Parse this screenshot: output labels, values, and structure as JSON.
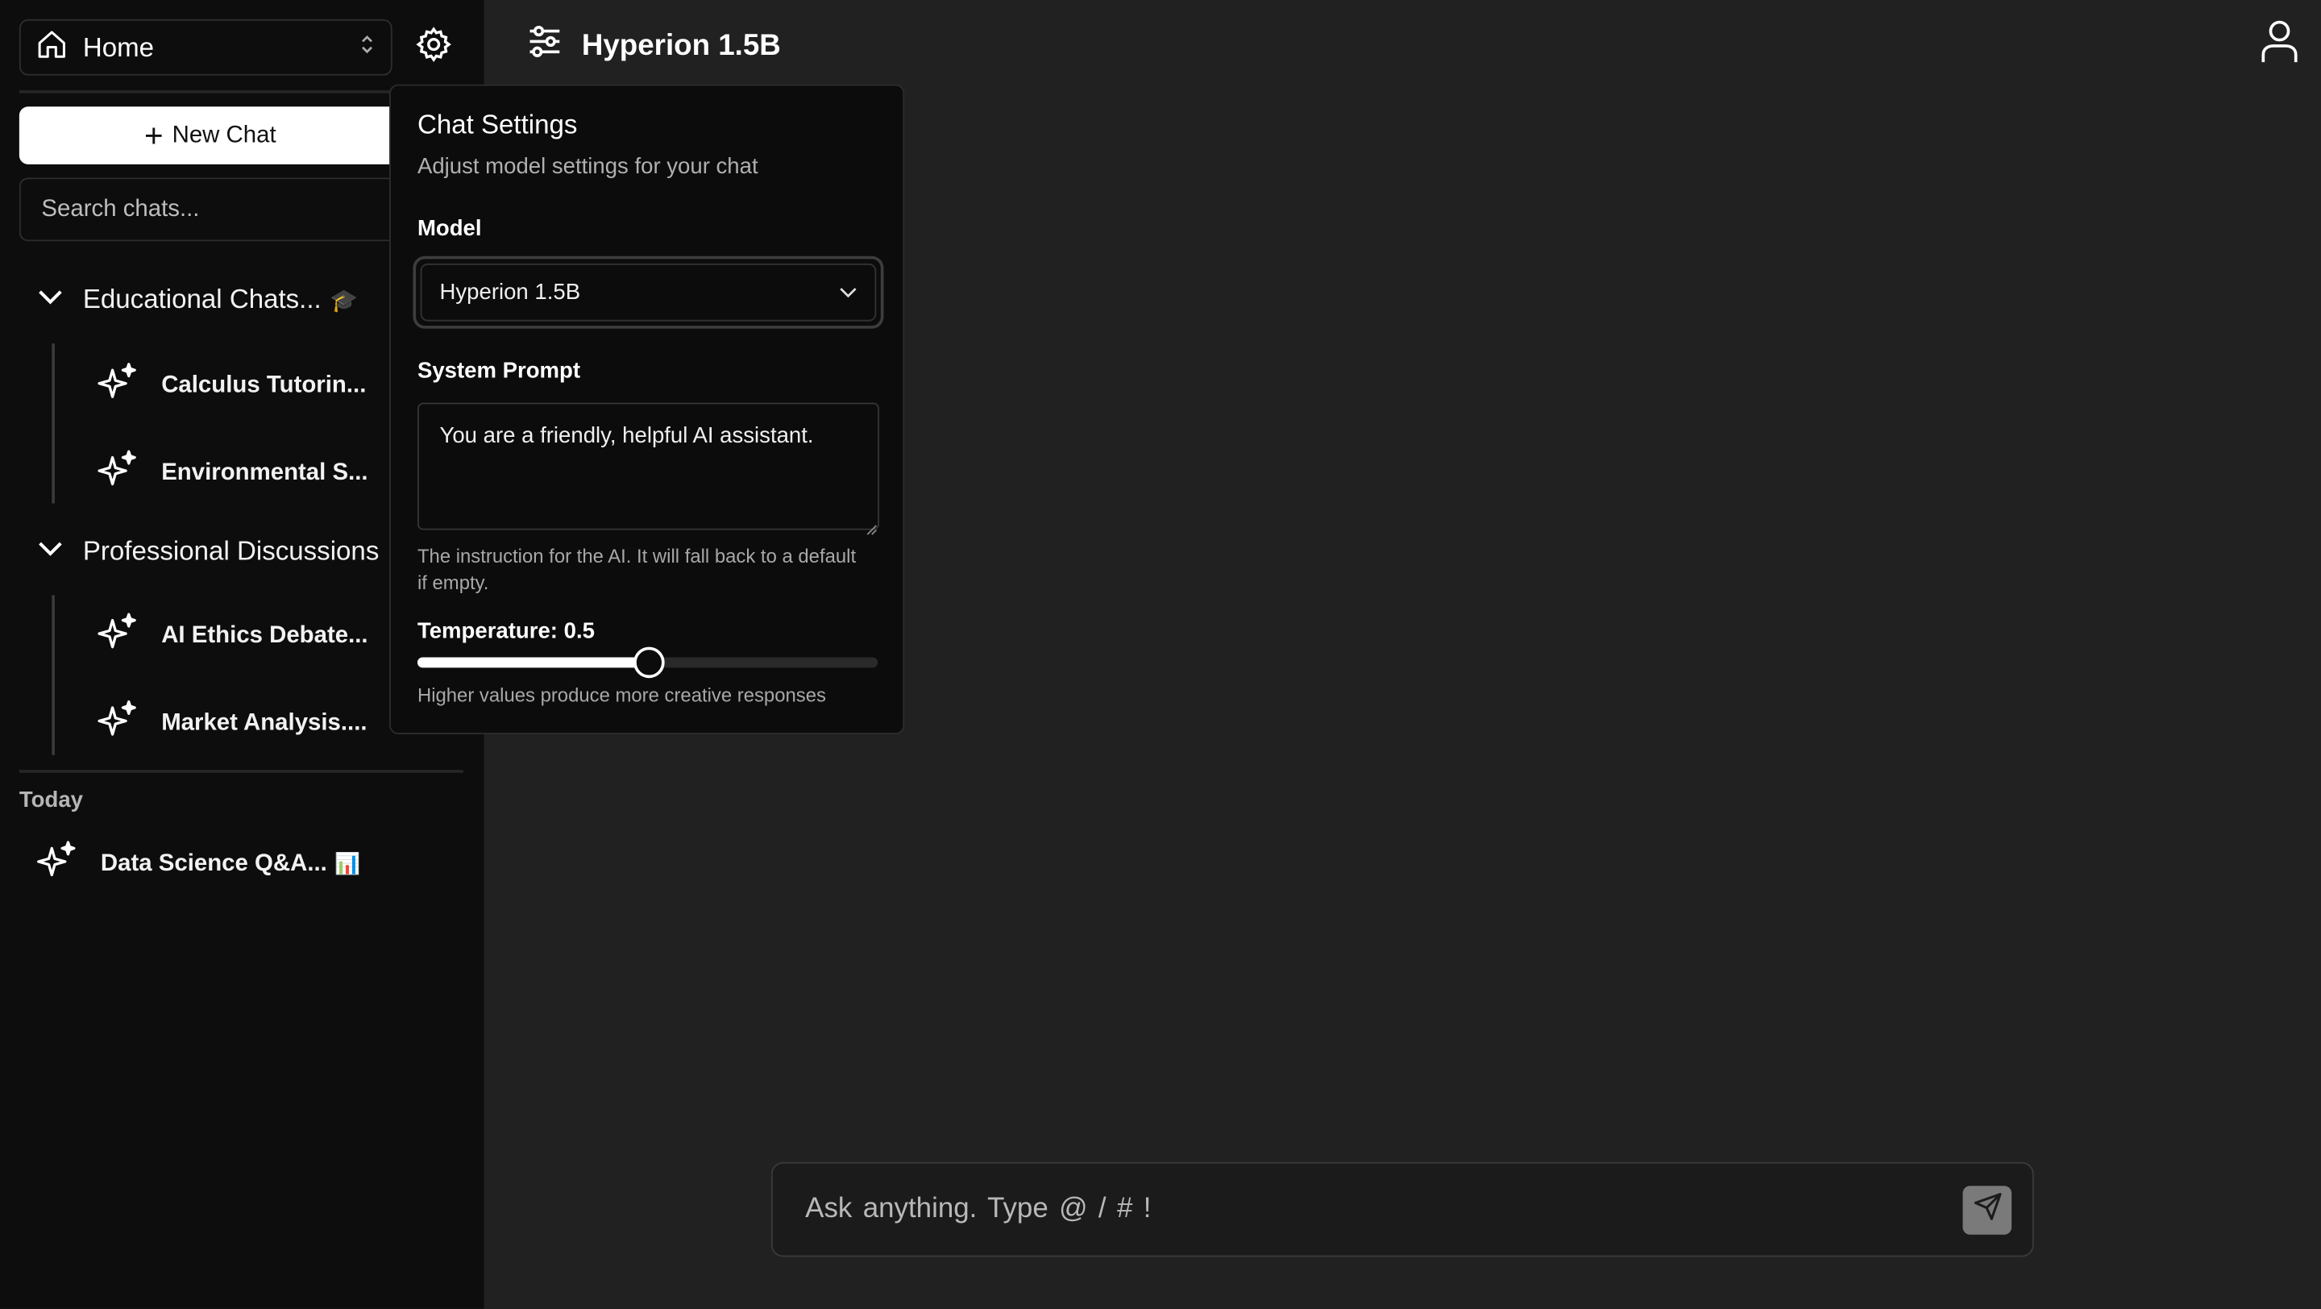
{
  "workspace": {
    "label": "Home",
    "icon": "home-icon"
  },
  "sidebar": {
    "new_chat_label": "New Chat",
    "search_placeholder": "Search chats...",
    "folders": [
      {
        "name": "Educational Chats...",
        "emoji": "🎓",
        "chats": [
          {
            "title": "Calculus Tutorin..."
          },
          {
            "title": "Environmental S..."
          }
        ]
      },
      {
        "name": "Professional Discussions",
        "emoji": "",
        "chats": [
          {
            "title": "AI Ethics Debate..."
          },
          {
            "title": "Market Analysis...."
          }
        ]
      }
    ],
    "sections": [
      {
        "label": "Today",
        "chats": [
          {
            "title": "Data Science Q&A...",
            "emoji": "📊"
          }
        ]
      }
    ]
  },
  "header": {
    "model_title": "Hyperion 1.5B",
    "icon": "sliders-icon"
  },
  "chat_settings": {
    "title": "Chat Settings",
    "subtitle": "Adjust model settings for your chat",
    "model_label": "Model",
    "model_value": "Hyperion 1.5B",
    "system_prompt_label": "System Prompt",
    "system_prompt_value": "You are a friendly, helpful AI assistant.",
    "system_prompt_help": "The instruction for the AI. It will fall back to a default if empty.",
    "temperature_label": "Temperature: 0.5",
    "temperature_value": 0.5,
    "temperature_max": 1.0,
    "temperature_help": "Higher values produce more creative responses"
  },
  "composer": {
    "placeholder": "Ask anything. Type @  /  #  !"
  },
  "colors": {
    "background": "#212121",
    "sidebar": "#0d0d0d",
    "popover": "#0c0c0c",
    "accent": "#ffffff"
  }
}
